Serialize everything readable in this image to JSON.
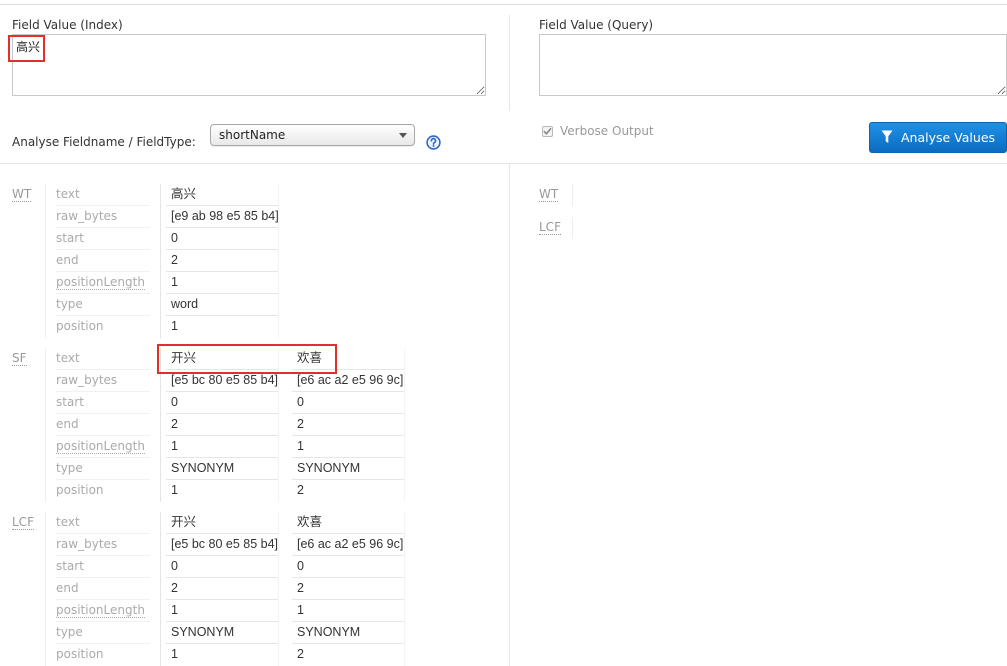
{
  "colors": {
    "annotation_red": "#e0302a",
    "button_gradient_top": "#1f91e6",
    "button_gradient_bottom": "#0b6cc0",
    "help_icon_blue": "#2f68c8"
  },
  "index_field": {
    "label": "Field Value (Index)",
    "value": "高兴"
  },
  "query_field": {
    "label": "Field Value (Query)",
    "value": ""
  },
  "fieldtype": {
    "label": "Analyse Fieldname / FieldType:",
    "selected": "shortName",
    "icon": "chevron-down-icon"
  },
  "help": {
    "icon": "question-circle-icon"
  },
  "verbose": {
    "label": "Verbose Output",
    "checked": true,
    "icon": "checkbox-checked-icon"
  },
  "analyse_button": {
    "label": "Analyse Values",
    "icon": "filter-icon"
  },
  "attribute_names": [
    "text",
    "raw_bytes",
    "start",
    "end",
    "positionLength",
    "type",
    "position"
  ],
  "index_analysis": [
    {
      "stage": "WT",
      "tokens": [
        {
          "text": "高兴",
          "raw_bytes": "[e9 ab 98 e5 85 b4]",
          "start": 0,
          "end": 2,
          "positionLength": 1,
          "type": "word",
          "position": 1
        }
      ]
    },
    {
      "stage": "SF",
      "tokens": [
        {
          "text": "开兴",
          "raw_bytes": "[e5 bc 80 e5 85 b4]",
          "start": 0,
          "end": 2,
          "positionLength": 1,
          "type": "SYNONYM",
          "position": 1
        },
        {
          "text": "欢喜",
          "raw_bytes": "[e6 ac a2 e5 96 9c]",
          "start": 0,
          "end": 2,
          "positionLength": 1,
          "type": "SYNONYM",
          "position": 2
        }
      ]
    },
    {
      "stage": "LCF",
      "tokens": [
        {
          "text": "开兴",
          "raw_bytes": "[e5 bc 80 e5 85 b4]",
          "start": 0,
          "end": 2,
          "positionLength": 1,
          "type": "SYNONYM",
          "position": 1
        },
        {
          "text": "欢喜",
          "raw_bytes": "[e6 ac a2 e5 96 9c]",
          "start": 0,
          "end": 2,
          "positionLength": 1,
          "type": "SYNONYM",
          "position": 2
        }
      ]
    }
  ],
  "query_analysis": [
    {
      "stage": "WT"
    },
    {
      "stage": "LCF"
    }
  ]
}
